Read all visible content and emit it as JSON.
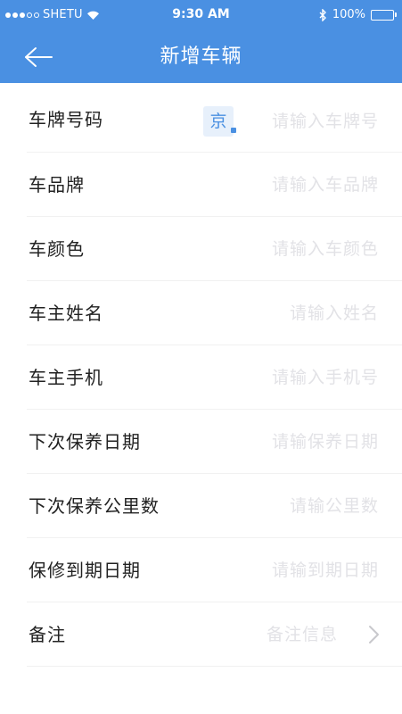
{
  "status_bar": {
    "carrier": "SHETU",
    "time": "9:30 AM",
    "battery": "100%",
    "battery_level": 100,
    "icons": [
      "signal-dots",
      "wifi-icon",
      "bluetooth-icon",
      "battery-icon"
    ]
  },
  "nav": {
    "title": "新增车辆",
    "back_icon": "arrow-left-icon"
  },
  "colors": {
    "header": "#4a90e2",
    "placeholder": "#e2e2e6",
    "label": "#222222",
    "divider": "#f1f1f1"
  },
  "form": {
    "plate": {
      "label": "车牌号码",
      "prefix": "京",
      "placeholder": "请输入车牌号"
    },
    "brand": {
      "label": "车品牌",
      "placeholder": "请输入车品牌"
    },
    "color": {
      "label": "车颜色",
      "placeholder": "请输入车颜色"
    },
    "owner_name": {
      "label": "车主姓名",
      "placeholder": "请输入姓名"
    },
    "owner_phone": {
      "label": "车主手机",
      "placeholder": "请输入手机号"
    },
    "next_service_date": {
      "label": "下次保养日期",
      "placeholder": "请输保养日期"
    },
    "next_service_mileage": {
      "label": "下次保养公里数",
      "placeholder": "请输公里数"
    },
    "warranty_expiry": {
      "label": "保修到期日期",
      "placeholder": "请输到期日期"
    },
    "remark": {
      "label": "备注",
      "placeholder": "备注信息",
      "icon": "chevron-right-icon"
    }
  }
}
